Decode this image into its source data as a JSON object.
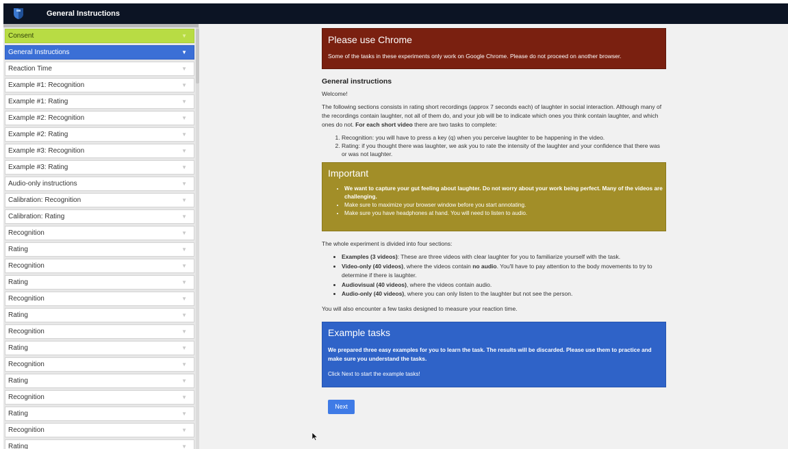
{
  "app": {
    "title": "General Instructions",
    "logo_icon": "shield-logo-icon"
  },
  "sidebar": {
    "chevron": "▼",
    "items": [
      "Consent",
      "General Instructions",
      "Reaction Time",
      "Example #1: Recognition",
      "Example #1: Rating",
      "Example #2: Recognition",
      "Example #2: Rating",
      "Example #3: Recognition",
      "Example #3: Rating",
      "Audio-only instructions",
      "Calibration: Recognition",
      "Calibration: Rating",
      "Recognition",
      "Rating",
      "Recognition",
      "Rating",
      "Recognition",
      "Rating",
      "Recognition",
      "Rating",
      "Recognition",
      "Rating",
      "Recognition",
      "Rating",
      "Recognition",
      "Rating"
    ]
  },
  "chrome_panel": {
    "title": "Please use Chrome",
    "body": "Some of the tasks in these experiments only work on Google Chrome. Please do not proceed on another browser."
  },
  "general": {
    "heading": "General instructions",
    "welcome": "Welcome!",
    "intro_part1": "The following sections consists in rating short recordings (approx 7 seconds each) of laughter in social interaction. Although many of the recordings contain laughter, not all of them do, and your job will be to indicate which ones you think contain laughter, and which ones do not. ",
    "intro_bold": "For each short video",
    "intro_part2": " there are two tasks to complete:",
    "steps": [
      "Recognition: you will have to press a key (q) when you perceive laughter to be happening in the video.",
      "Rating: if you thought there was laughter, we ask you to rate the intensity of the laughter and your confidence that there was or was not laughter."
    ]
  },
  "important_panel": {
    "title": "Important",
    "bullet1": "We want to capture your gut feeling about laughter. Do not worry about your work being perfect. Many of the videos are challenging.",
    "bullet2": "Make sure to maximize your browser window before you start annotating.",
    "bullet3": "Make sure you have headphones at hand. You will need to listen to audio."
  },
  "experiment": {
    "intro": "The whole experiment is divided into four sections:",
    "s1_bold": "Examples (3 videos)",
    "s1_text": ": These are three videos with clear laughter for you to familiarize yourself with the task.",
    "s2_bold": "Video-only (40 videos)",
    "s2_text_a": ", where the videos contain ",
    "s2_bold2": "no audio",
    "s2_text_b": ". You'll have to pay attention to the body movements to try to determine if there is laughter.",
    "s3_bold": "Audiovisual (40 videos)",
    "s3_text": ", where the videos contain audio.",
    "s4_bold": "Audio-only (40 videos)",
    "s4_text": ", where you can only listen to the laughter but not see the person.",
    "reaction_note": "You will also encounter a few tasks designed to measure your reaction time."
  },
  "example_panel": {
    "title": "Example tasks",
    "bold_text": "We prepared three easy examples for you to learn the task. The results will be discarded. Please use them to practice and make sure you understand the tasks.",
    "click_text": "Click Next to start the example tasks!"
  },
  "next_button": "Next",
  "colors": {
    "topbar": "#0c1424",
    "consent": "#b8dc44",
    "active": "#3b6fd6",
    "chrome_panel": "#7a2010",
    "important_panel": "#a28e28",
    "example_panel": "#2f63c8",
    "next_button": "#3f7be6"
  }
}
